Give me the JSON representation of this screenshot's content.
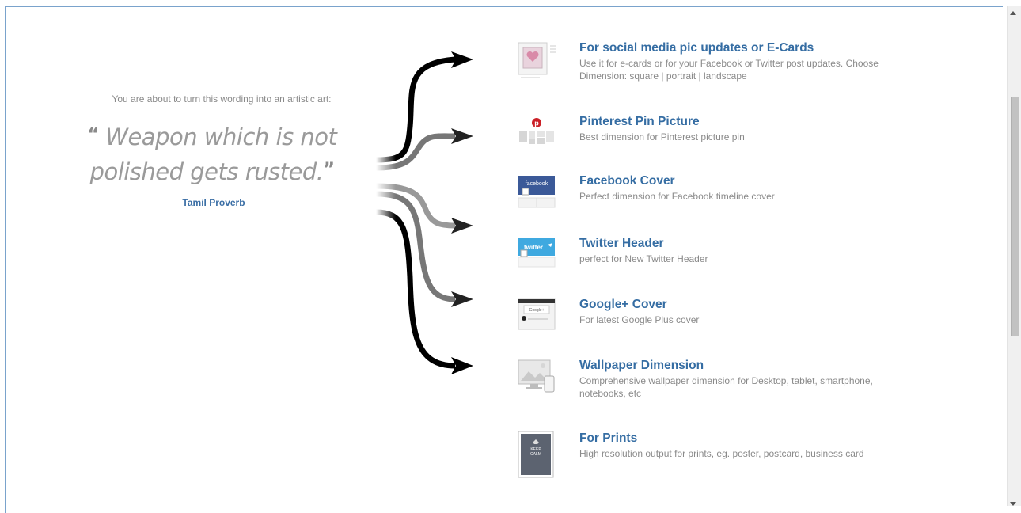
{
  "intro_text": "You are about to turn this wording into an artistic art:",
  "quote": {
    "open_mark": "“",
    "line1": "Weapon which is not",
    "line2": "polished gets rusted.",
    "close_mark": "”",
    "author": "Tamil Proverb"
  },
  "options": [
    {
      "title": "For social media pic updates or E-Cards",
      "desc": "Use it for e-cards or for your Facebook or Twitter post updates. Choose Dimension: square | portrait | landscape",
      "icon": "ecard-icon"
    },
    {
      "title": "Pinterest Pin Picture",
      "desc": "Best dimension for Pinterest picture pin",
      "icon": "pinterest-icon"
    },
    {
      "title": "Facebook Cover",
      "desc": "Perfect dimension for Facebook timeline cover",
      "icon": "facebook-cover-icon",
      "icon_label": "facebook"
    },
    {
      "title": "Twitter Header",
      "desc": "perfect for New Twitter Header",
      "icon": "twitter-header-icon",
      "icon_label": "twitter"
    },
    {
      "title": "Google+ Cover",
      "desc": "For latest Google Plus cover",
      "icon": "google-plus-cover-icon",
      "icon_label": "Google+"
    },
    {
      "title": "Wallpaper Dimension",
      "desc": "Comprehensive wallpaper dimension for Desktop, tablet, smartphone, notebooks, etc",
      "icon": "wallpaper-icon"
    },
    {
      "title": "For Prints",
      "desc": "High resolution output for prints, eg. poster, postcard, business card",
      "icon": "print-icon",
      "icon_label": "KEEP CALM"
    }
  ],
  "colors": {
    "link_blue": "#356da3",
    "muted_text": "#8a8a8a",
    "facebook_blue": "#3b5998",
    "twitter_blue": "#3fa9e0",
    "pinterest_red": "#cb2027"
  }
}
